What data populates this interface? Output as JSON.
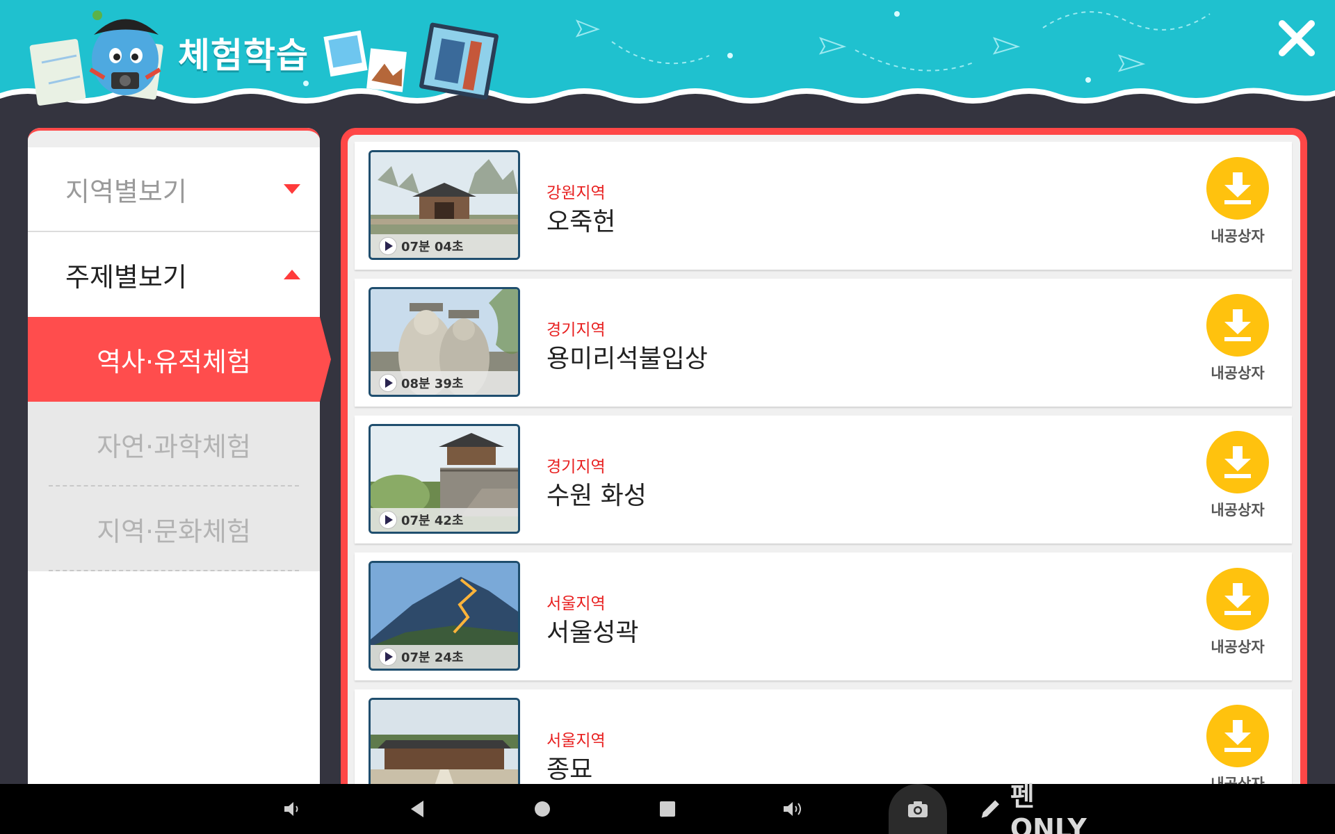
{
  "header": {
    "title": "체험학습",
    "close_icon": "close-icon"
  },
  "sidebar": {
    "categories": [
      {
        "label": "지역별보기",
        "state": "collapsed",
        "icon": "caret-down-icon"
      },
      {
        "label": "주제별보기",
        "state": "expanded",
        "icon": "caret-up-icon"
      }
    ],
    "subitems": [
      {
        "label": "역사·유적체험",
        "active": true
      },
      {
        "label": "자연·과학체험",
        "active": false
      },
      {
        "label": "지역·문화체험",
        "active": false
      }
    ]
  },
  "videos": [
    {
      "region": "강원지역",
      "title": "오죽헌",
      "duration": "07분 04초",
      "download_label": "내공상자",
      "thumb": "traditional-house"
    },
    {
      "region": "경기지역",
      "title": "용미리석불입상",
      "duration": "08분 39초",
      "download_label": "내공상자",
      "thumb": "stone-buddha"
    },
    {
      "region": "경기지역",
      "title": "수원 화성",
      "duration": "07분 42초",
      "download_label": "내공상자",
      "thumb": "fortress"
    },
    {
      "region": "서울지역",
      "title": "서울성곽",
      "duration": "07분 24초",
      "download_label": "내공상자",
      "thumb": "mountain-wall"
    },
    {
      "region": "서울지역",
      "title": "종묘",
      "duration": "",
      "download_label": "내공상자",
      "thumb": "shrine"
    }
  ],
  "navbar": {
    "pen_label": "펜 ONLY",
    "icons": [
      "volume-down-icon",
      "back-icon",
      "home-icon",
      "recents-icon",
      "volume-up-icon",
      "camera-icon",
      "pen-icon"
    ]
  },
  "colors": {
    "header_teal": "#1fc1cf",
    "accent_red": "#ff4d4d",
    "download_yellow": "#ffc20e",
    "region_red": "#e82020",
    "background_dark": "#34343f"
  }
}
